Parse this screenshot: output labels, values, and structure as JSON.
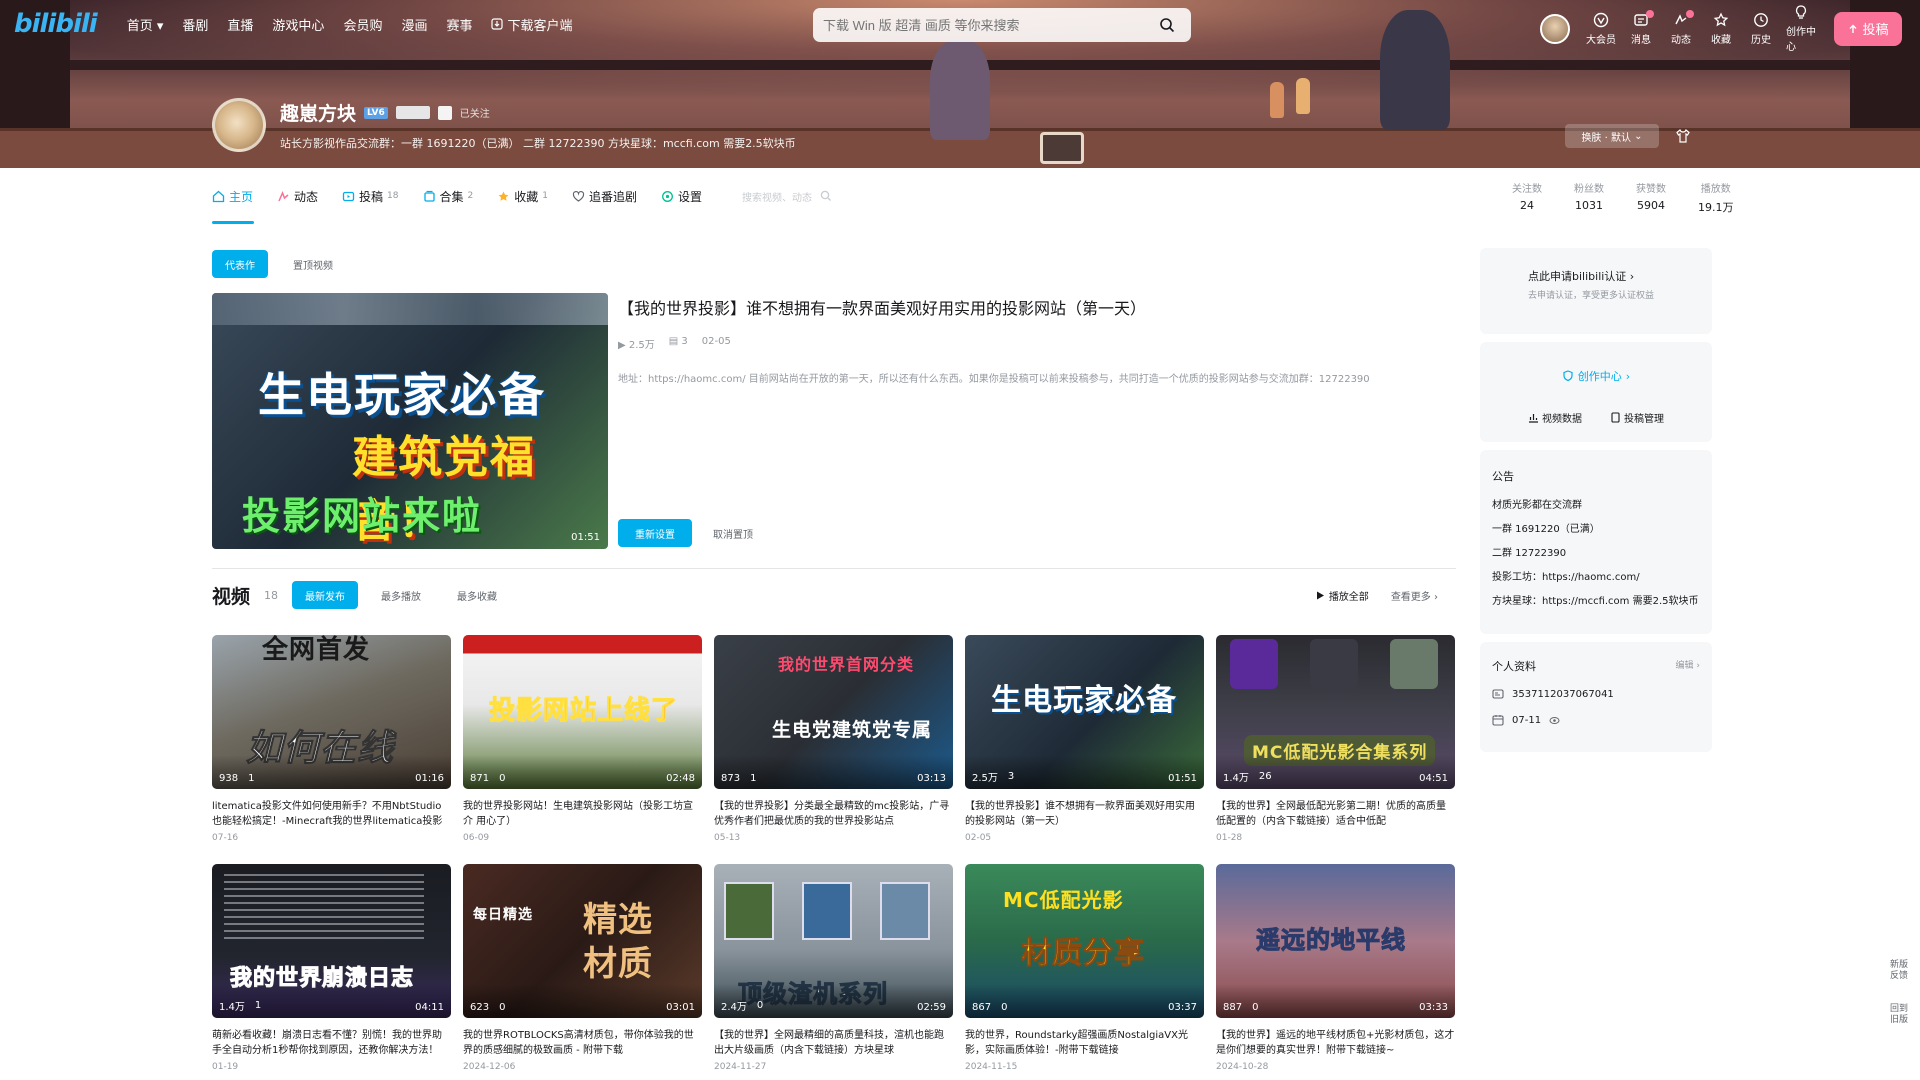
{
  "nav": {
    "logo": "bilibili",
    "links": [
      "首页",
      "番剧",
      "直播",
      "游戏中心",
      "会员购",
      "漫画",
      "赛事"
    ],
    "download": "下载客户端",
    "search_placeholder": "下载 Win 版 超清 画质 等你来搜索",
    "right_items": [
      "大会员",
      "消息",
      "动态",
      "收藏",
      "历史",
      "创作中心"
    ],
    "upload": "投稿"
  },
  "profile": {
    "name": "趣崽方块",
    "level": "LV6",
    "follow_label": "已关注",
    "sign": "站长方影视作品交流群：一群 1691220（已满） 二群 12722390 方块星球：mccfi.com 需要2.5软块币",
    "theme_button": "换肤 · 默认",
    "theme_chevron": "chevron-down"
  },
  "tabs": [
    {
      "label": "主页",
      "count": "",
      "icon": "home"
    },
    {
      "label": "动态",
      "count": "",
      "icon": "dynamic"
    },
    {
      "label": "投稿",
      "count": "18",
      "icon": "video"
    },
    {
      "label": "合集",
      "count": "2",
      "icon": "collection"
    },
    {
      "label": "收藏",
      "count": "1",
      "icon": "star"
    },
    {
      "label": "追番追剧",
      "count": "",
      "icon": "heart"
    },
    {
      "label": "设置",
      "count": "",
      "icon": "gear"
    }
  ],
  "tab_search_placeholder": "搜索视频、动态",
  "stats": [
    {
      "label": "关注数",
      "value": "24"
    },
    {
      "label": "粉丝数",
      "value": "1031"
    },
    {
      "label": "获赞数",
      "value": "5904"
    },
    {
      "label": "播放数",
      "value": "19.1万"
    }
  ],
  "sub_tabs": [
    "代表作",
    "置顶视频"
  ],
  "featured": {
    "title": "【我的世界投影】谁不想拥有一款界面美观好用实用的投影网站（第一天）",
    "views": "2.5万",
    "danmaku": "3",
    "date": "02-05",
    "desc_prefix": "地址：",
    "desc_link": "https://haomc.com/",
    "desc": " 目前网站尚在开放的第一天，所以还有什么东西。如果你是投稿可以前来投稿参与，共同打造一个优质的投影网站参与交流加群：12722390",
    "thumb_line1": "生电玩家必备",
    "thumb_line2": "建筑党福音！",
    "thumb_line3": "投影网站来啦",
    "duration": "01:51",
    "btn_primary": "重新设置",
    "btn_plain": "取消置顶"
  },
  "videos_section": {
    "title": "视频",
    "count": "18",
    "sort_pills": [
      "最新发布",
      "最多播放",
      "最多收藏"
    ],
    "play_all": "播放全部",
    "more": "查看更多"
  },
  "videos": [
    {
      "title": "litematica投影文件如何使用新手？不用NbtStudio也能轻松搞定！-Minecraft我的世界litematica投影",
      "views": "938",
      "danmaku": "1",
      "dur": "01:16",
      "date": "07-16",
      "thumb": "如何在线",
      "thumb_top": "全网首发"
    },
    {
      "title": "我的世界投影网站！生电建筑投影网站（投影工坊宣介 用心了）",
      "views": "871",
      "danmaku": "0",
      "dur": "02:48",
      "date": "06-09",
      "thumb": "投影网站上线了",
      "thumb_top": ""
    },
    {
      "title": "【我的世界投影】分类最全最精致的mc投影站，广寻优秀作者们把最优质的我的世界投影站点",
      "views": "873",
      "danmaku": "1",
      "dur": "03:13",
      "date": "05-13",
      "thumb": "生电党建筑党专属",
      "thumb_top": "我的世界首网分类"
    },
    {
      "title": "【我的世界投影】谁不想拥有一款界面美观好用实用的投影网站（第一天）",
      "views": "2.5万",
      "danmaku": "3",
      "dur": "01:51",
      "date": "02-05",
      "thumb": "生电玩家必备",
      "thumb_top": ""
    },
    {
      "title": "【我的世界】全网最低配光影第二期！优质的高质量低配置的（内含下载链接）适合中低配",
      "views": "1.4万",
      "danmaku": "26",
      "dur": "04:51",
      "date": "01-28",
      "thumb": "MC低配光影合集系列",
      "thumb_top": ""
    },
    {
      "title": "萌新必看收藏！崩溃日志看不懂？别慌！我的世界助手全自动分析1秒帮你找到原因，还教你解决方法！",
      "views": "1.4万",
      "danmaku": "1",
      "dur": "04:11",
      "date": "01-19",
      "thumb": "我的世界崩溃日志",
      "thumb_top": ""
    },
    {
      "title": "我的世界ROTBLOCKS高清材质包，带你体验我的世界的质感细腻的极致画质 - 附带下载",
      "views": "623",
      "danmaku": "0",
      "dur": "03:01",
      "date": "2024-12-06",
      "thumb": "精选材质",
      "thumb_top": "每日精选"
    },
    {
      "title": "【我的世界】全网最精细的高质量科技，渲机也能跑出大片级画质（内含下载链接）方块星球",
      "views": "2.4万",
      "danmaku": "0",
      "dur": "02:59",
      "date": "2024-11-27",
      "thumb": "顶级渣机系列",
      "thumb_top": ""
    },
    {
      "title": "我的世界，Roundstarky超强画质NostalgiaVX光影，实际画质体验！-附带下载链接",
      "views": "867",
      "danmaku": "0",
      "dur": "03:37",
      "date": "2024-11-15",
      "thumb": "材质分享",
      "thumb_top": "MC低配光影"
    },
    {
      "title": "【我的世界】遥远的地平线材质包+光影材质包，这才是你们想要的真实世界！附带下载链接~",
      "views": "887",
      "danmaku": "0",
      "dur": "03:33",
      "date": "2024-10-28",
      "thumb": "遥远的地平线",
      "thumb_top": ""
    }
  ],
  "side": {
    "cert_title": "点此申请bilibili认证",
    "cert_sub": "去申请认证，享受更多认证权益",
    "creator": "创作中心",
    "creator_links": [
      "视频数据",
      "投稿管理"
    ],
    "notice_title": "公告",
    "notice_lines": [
      "材质光影都在交流群",
      "一群 1691220（已满）",
      "二群 12722390",
      "投影工坊：https://haomc.com/",
      "方块星球：https://mccfi.com 需要2.5软块币"
    ],
    "profile_title": "个人资料",
    "profile_more": "编辑",
    "uid": "3537112037067041",
    "birthday": "07-11"
  },
  "float_buttons": [
    "新版反馈",
    "回到旧版"
  ]
}
